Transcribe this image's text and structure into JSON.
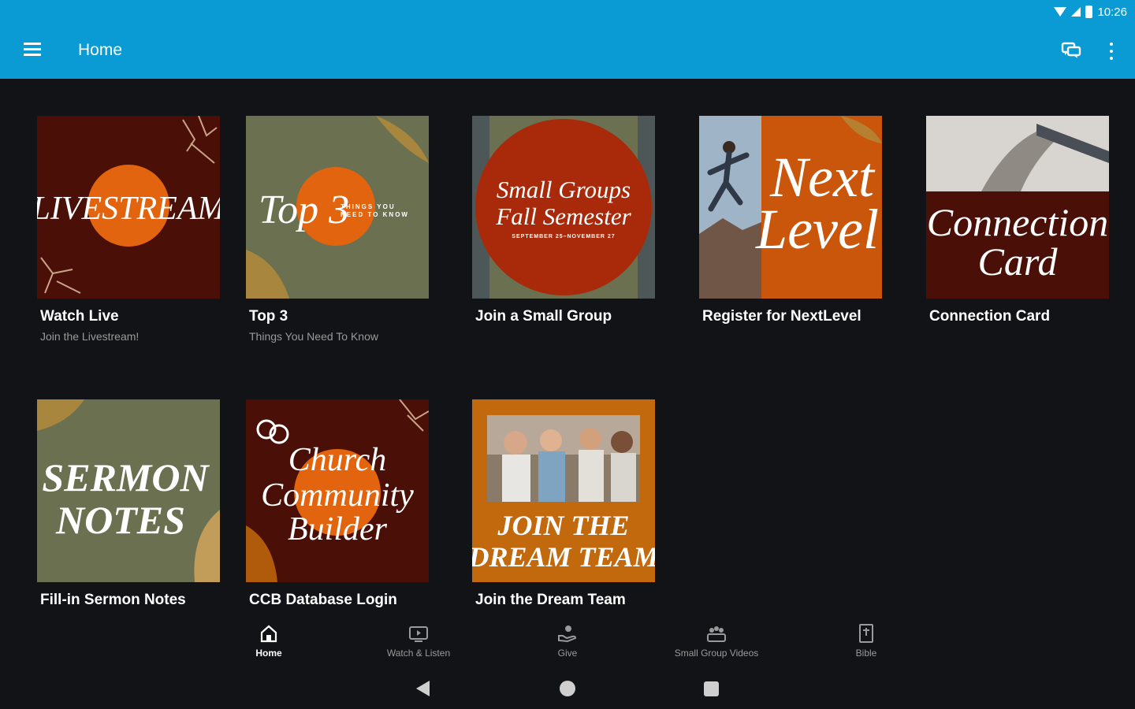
{
  "status_bar": {
    "time": "10:26"
  },
  "app_bar": {
    "title": "Home",
    "icons": [
      "menu-icon",
      "chat-icon",
      "more-vert-icon"
    ]
  },
  "cards": [
    {
      "title": "Watch Live",
      "subtitle": "Join the Livestream!",
      "image_text": [
        "LIVESTREAM"
      ]
    },
    {
      "title": "Top 3",
      "subtitle": "Things You Need To Know",
      "image_text": [
        "Top 3",
        "THINGS YOU",
        "NEED TO KNOW"
      ]
    },
    {
      "title": "Join a Small Group",
      "subtitle": "",
      "image_text": [
        "Small Groups",
        "Fall Semester",
        "SEPTEMBER 25–NOVEMBER 27"
      ]
    },
    {
      "title": "Register for NextLevel",
      "subtitle": "",
      "image_text": [
        "Next",
        "Level"
      ]
    },
    {
      "title": "Connection Card",
      "subtitle": "",
      "image_text": [
        "Connection",
        "Card"
      ]
    },
    {
      "title": "Fill-in Sermon Notes",
      "subtitle": "",
      "image_text": [
        "SERMON",
        "NOTES"
      ]
    },
    {
      "title": "CCB Database Login",
      "subtitle": "",
      "image_text": [
        "Church",
        "Community",
        "Builder"
      ]
    },
    {
      "title": "Join the Dream Team",
      "subtitle": "",
      "image_text": [
        "JOIN THE",
        "DREAM TEAM"
      ]
    }
  ],
  "bottom_nav": [
    {
      "label": "Home",
      "icon": "home-icon",
      "active": true
    },
    {
      "label": "Watch & Listen",
      "icon": "tv-icon",
      "active": false
    },
    {
      "label": "Give",
      "icon": "give-hand-icon",
      "active": false
    },
    {
      "label": "Small Group Videos",
      "icon": "group-icon",
      "active": false
    },
    {
      "label": "Bible",
      "icon": "bible-icon",
      "active": false
    }
  ],
  "colors": {
    "app_bar": "#0a9ad4",
    "background": "#121316",
    "orange": "#e3640f",
    "maroon": "#4a0f06",
    "olive": "#6b7150",
    "amber": "#c2690e"
  }
}
